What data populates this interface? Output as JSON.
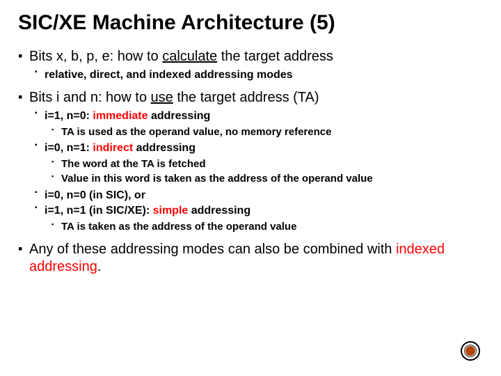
{
  "title": "SIC/XE Machine Architecture (5)",
  "b1_pre": "Bits x, b, p, e: how to ",
  "b1_calc": "calculate",
  "b1_post": " the target address",
  "b1a": "relative, direct, and indexed addressing modes",
  "b2_pre": "Bits i and n: how to ",
  "b2_use": "use",
  "b2_post": " the target address (TA)",
  "b2a_pre": "i=1, n=0: ",
  "b2a_imm": "immediate",
  "b2a_post": " addressing",
  "b2a_i": "TA is used as the operand value, no memory reference",
  "b2b_pre": "i=0, n=1: ",
  "b2b_ind": "indirect",
  "b2b_post": " addressing",
  "b2b_i": "The word at the TA is fetched",
  "b2b_ii": "Value in this word is taken as the address of the operand value",
  "b2c": "i=0, n=0 (in SIC), or",
  "b2d_pre": "i=1, n=1 (in SIC/XE): ",
  "b2d_simple": "simple",
  "b2d_post": " addressing",
  "b2d_i": "TA is taken as the address of the operand value",
  "b3_pre": "Any of these addressing modes can also be combined with ",
  "b3_idx": "indexed addressing",
  "b3_post": ".",
  "badge": "decorative-badge"
}
